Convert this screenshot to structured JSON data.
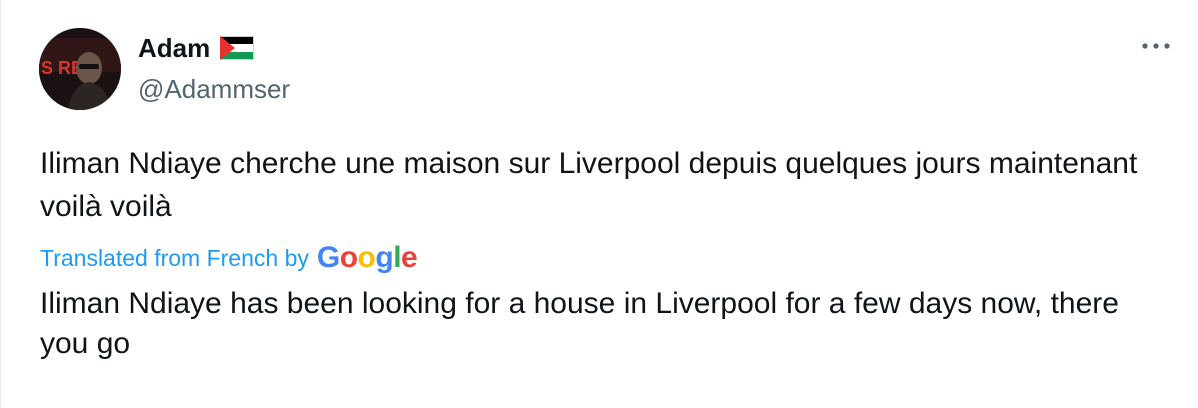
{
  "author": {
    "display_name": "Adam",
    "handle": "@Adammser",
    "name_emoji": "flag-icon",
    "avatar_text": "S RE"
  },
  "tweet": {
    "original_text": "Iliman Ndiaye cherche une maison sur Liverpool depuis quelques jours maintenant voilà voilà",
    "translation_label": "Translated from French by",
    "translation_provider": {
      "letters": [
        "G",
        "o",
        "o",
        "g",
        "l",
        "e"
      ]
    },
    "translated_text": "Iliman Ndiaye has been looking for a house in Liverpool for a few days now, there you go"
  },
  "colors": {
    "link": "#1d9bf0",
    "text": "#0f1419",
    "secondary": "#536471"
  },
  "icons": {
    "more": "more-horizontal-icon",
    "flag": "palestine-flag-icon"
  }
}
